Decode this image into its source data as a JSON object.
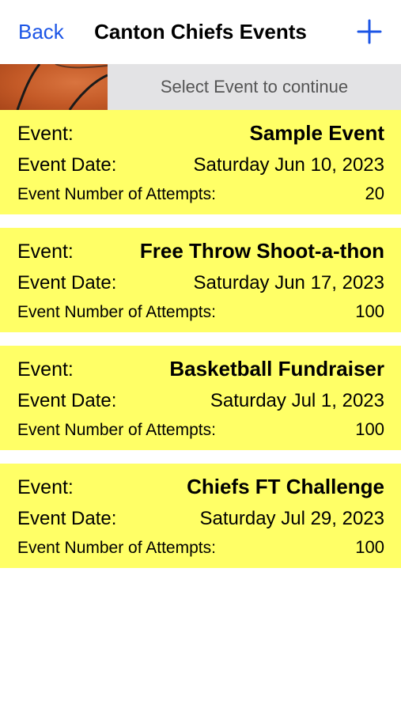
{
  "nav": {
    "back_label": "Back",
    "title": "Canton Chiefs Events",
    "add_icon": "plus-icon"
  },
  "banner": {
    "image": "basketball-image",
    "prompt": "Select Event to continue"
  },
  "labels": {
    "event": "Event:",
    "event_date": "Event Date:",
    "attempts": "Event Number of Attempts:"
  },
  "events": [
    {
      "name": "Sample Event",
      "date": "Saturday Jun 10, 2023",
      "attempts": "20"
    },
    {
      "name": "Free Throw Shoot-a-thon",
      "date": "Saturday Jun 17, 2023",
      "attempts": "100"
    },
    {
      "name": "Basketball Fundraiser",
      "date": "Saturday Jul 1, 2023",
      "attempts": "100"
    },
    {
      "name": "Chiefs FT Challenge",
      "date": "Saturday Jul 29, 2023",
      "attempts": "100"
    }
  ],
  "colors": {
    "accent": "#1c55e6",
    "card_background": "#ffff66",
    "banner_background": "#e3e3e5",
    "banner_text": "#555555"
  }
}
